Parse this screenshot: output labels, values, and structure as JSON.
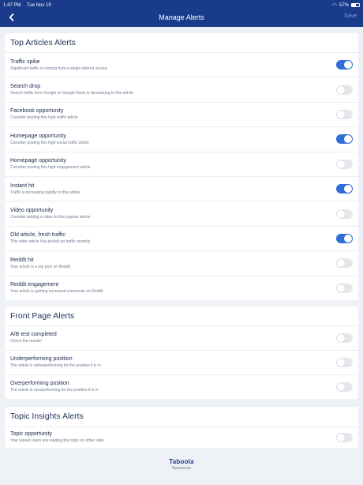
{
  "status_bar": {
    "time": "1:47 PM",
    "date": "Tue Nov 19",
    "battery": "57%"
  },
  "header": {
    "title": "Manage Alerts",
    "save_label": "Save"
  },
  "sections": [
    {
      "title": "Top Articles Alerts",
      "items": [
        {
          "title": "Traffic spike",
          "subtitle": "Significant traffic is coming from a single referral source",
          "enabled": true
        },
        {
          "title": "Search drop",
          "subtitle": "Search traffic from Google or Google News is decreasing to this article",
          "enabled": false
        },
        {
          "title": "Facebook opportunity",
          "subtitle": "Consider posting this high traffic article",
          "enabled": false
        },
        {
          "title": "Homepage opportunity",
          "subtitle": "Consider posting this high social traffic article",
          "enabled": true
        },
        {
          "title": "Homepage opportunity",
          "subtitle": "Consider posting this high engagement article",
          "enabled": false
        },
        {
          "title": "Instant hit",
          "subtitle": "Traffic is increasing rapidly to this article",
          "enabled": true
        },
        {
          "title": "Video opportunity",
          "subtitle": "Consider adding a video to this popular article",
          "enabled": false
        },
        {
          "title": "Old article, fresh traffic",
          "subtitle": "This older article has picked up traffic recently",
          "enabled": true
        },
        {
          "title": "Reddit hit",
          "subtitle": "Your article is a top post on Reddit",
          "enabled": false
        },
        {
          "title": "Reddit engagement",
          "subtitle": "Your article is gaining increased comments on Reddit",
          "enabled": false
        }
      ]
    },
    {
      "title": "Front Page Alerts",
      "items": [
        {
          "title": "A/B test completed",
          "subtitle": "Check the results!",
          "enabled": false
        },
        {
          "title": "Underperforming position",
          "subtitle": "The article is underperforming for the position it is in",
          "enabled": false
        },
        {
          "title": "Overperforming position",
          "subtitle": "The article is overperforming for the position it is in",
          "enabled": false
        }
      ]
    },
    {
      "title": "Topic Insights Alerts",
      "items": [
        {
          "title": "Topic opportunity",
          "subtitle": "Your repeat users are reading this topic on other sites",
          "enabled": false
        }
      ]
    }
  ],
  "footer": {
    "brand": "Taboola",
    "product": "Newsroom"
  },
  "colors": {
    "header_bg": "#1a3a8a",
    "toggle_on": "#2f6fd6",
    "toggle_off": "#e4e7eb"
  },
  "icons": {
    "back": "chevron-left-icon",
    "wifi": "wifi-icon",
    "battery": "battery-icon"
  }
}
